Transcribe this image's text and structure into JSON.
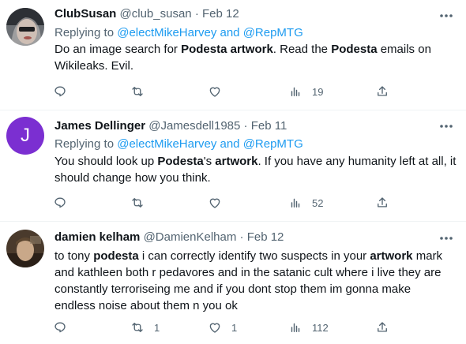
{
  "tweets": [
    {
      "name": "ClubSusan",
      "handle": "@club_susan",
      "separator": "·",
      "date": "Feb 12",
      "replying_prefix": "Replying to ",
      "replying_mention_1": "@electMikeHarvey",
      "replying_and": " and ",
      "replying_mention_2": "@RepMTG",
      "body": [
        {
          "text": "Do an image search for ",
          "bold": false
        },
        {
          "text": "Podesta artwork",
          "bold": true
        },
        {
          "text": ".  Read the ",
          "bold": false
        },
        {
          "text": "Podesta",
          "bold": true
        },
        {
          "text": " emails on Wikileaks.  Evil.",
          "bold": false
        }
      ],
      "replies": "",
      "retweets": "",
      "likes": "",
      "views": "19"
    },
    {
      "name": "James Dellinger",
      "handle": "@Jamesdell1985",
      "separator": "·",
      "date": "Feb 11",
      "avatar_letter": "J",
      "replying_prefix": "Replying to ",
      "replying_mention_1": "@electMikeHarvey",
      "replying_and": " and ",
      "replying_mention_2": "@RepMTG",
      "body": [
        {
          "text": "You should look up ",
          "bold": false
        },
        {
          "text": "Podesta",
          "bold": true
        },
        {
          "text": "'s ",
          "bold": false
        },
        {
          "text": "artwork",
          "bold": true
        },
        {
          "text": ". If you have any humanity left at all, it should change how you think.",
          "bold": false
        }
      ],
      "replies": "",
      "retweets": "",
      "likes": "",
      "views": "52"
    },
    {
      "name": "damien kelham",
      "handle": "@DamienKelham",
      "separator": "·",
      "date": "Feb 12",
      "body": [
        {
          "text": "to tony ",
          "bold": false
        },
        {
          "text": "podesta",
          "bold": true
        },
        {
          "text": " i can correctly identify two suspects in your ",
          "bold": false
        },
        {
          "text": "artwork",
          "bold": true
        },
        {
          "text": " mark and kathleen both r pedavores and in the satanic cult where i live they are constantly terroriseing me and if you dont stop them im gonna make endless noise about them n you ok",
          "bold": false
        }
      ],
      "replies": "",
      "retweets": "1",
      "likes": "1",
      "views": "112"
    }
  ],
  "colors": {
    "text": "#0f1419",
    "secondary": "#536471",
    "link": "#1d9bf0",
    "divider": "#eff3f4",
    "avatar_purple": "#7b2fd1"
  },
  "icons": [
    "reply-icon",
    "retweet-icon",
    "like-icon",
    "views-icon",
    "share-icon",
    "more-icon"
  ]
}
